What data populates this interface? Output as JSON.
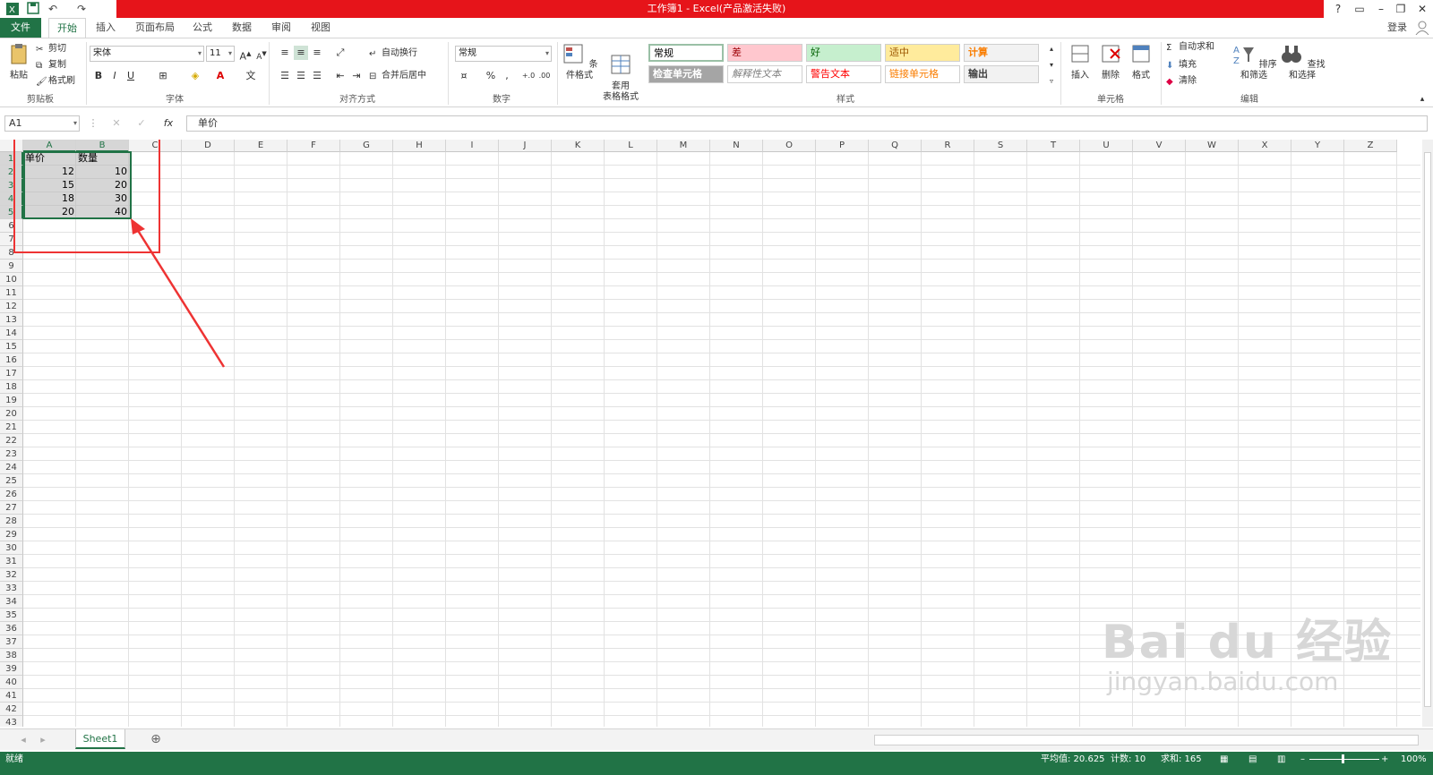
{
  "window": {
    "title": "工作簿1 -  Excel(产品激活失败)",
    "login": "登录",
    "help": "?",
    "minimize": "–",
    "restore": "❐",
    "close": "✕"
  },
  "tabs": [
    "文件",
    "开始",
    "插入",
    "页面布局",
    "公式",
    "数据",
    "审阅",
    "视图"
  ],
  "clipboard": {
    "paste": "粘贴",
    "cut": "剪切",
    "copy": "复制",
    "format_painter": "格式刷",
    "label": "剪贴板"
  },
  "font": {
    "name": "宋体",
    "size": "11",
    "bold": "B",
    "italic": "I",
    "underline": "U",
    "label": "字体"
  },
  "alignment": {
    "wrap": "自动换行",
    "merge": "合并后居中",
    "label": "对齐方式"
  },
  "number": {
    "format": "常规",
    "label": "数字"
  },
  "styles": {
    "cond_format": "条件格式",
    "table_format": "套用\n表格格式",
    "cells": [
      {
        "text": "常规",
        "bg": "#ffffff",
        "color": "#000000"
      },
      {
        "text": "差",
        "bg": "#ffc7ce",
        "color": "#9c0006"
      },
      {
        "text": "好",
        "bg": "#c6efce",
        "color": "#006100"
      },
      {
        "text": "适中",
        "bg": "#ffeb9c",
        "color": "#9c5700"
      },
      {
        "text": "计算",
        "bg": "#f2f2f2",
        "color": "#fa7d00"
      },
      {
        "text": "检查单元格",
        "bg": "#a5a5a5",
        "color": "#ffffff"
      },
      {
        "text": "解释性文本",
        "bg": "#ffffff",
        "color": "#7f7f7f"
      },
      {
        "text": "警告文本",
        "bg": "#ffffff",
        "color": "#ff0000"
      },
      {
        "text": "链接单元格",
        "bg": "#ffffff",
        "color": "#fa7d00"
      },
      {
        "text": "输出",
        "bg": "#f2f2f2",
        "color": "#3f3f3f"
      }
    ],
    "label": "样式"
  },
  "cells_group": {
    "insert": "插入",
    "delete": "删除",
    "format": "格式",
    "label": "单元格"
  },
  "editing": {
    "autosum": "自动求和",
    "fill": "填充",
    "clear": "清除",
    "sort_filter": "排序和筛选",
    "find_select": "查找和选择",
    "label": "编辑"
  },
  "formula_bar": {
    "name_box": "A1",
    "fx": "fx",
    "content": "单价"
  },
  "columns": [
    "A",
    "B",
    "C",
    "D",
    "E",
    "F",
    "G",
    "H",
    "I",
    "J",
    "K",
    "L",
    "M",
    "N",
    "O",
    "P",
    "Q",
    "R",
    "S",
    "T",
    "U",
    "V",
    "W",
    "X",
    "Y",
    "Z"
  ],
  "rows": [
    "1",
    "2",
    "3",
    "4",
    "5",
    "6",
    "7",
    "8",
    "9",
    "10",
    "11",
    "12",
    "13",
    "14",
    "15",
    "16",
    "17",
    "18",
    "19",
    "20",
    "21",
    "22",
    "23",
    "24",
    "25",
    "26",
    "27",
    "28",
    "29",
    "30",
    "31",
    "32",
    "33",
    "34",
    "35",
    "36",
    "37",
    "38",
    "39",
    "40",
    "41",
    "42",
    "43"
  ],
  "data": {
    "headers": [
      "单价",
      "数量"
    ],
    "rows": [
      [
        "12",
        "10"
      ],
      [
        "15",
        "20"
      ],
      [
        "18",
        "30"
      ],
      [
        "20",
        "40"
      ]
    ]
  },
  "sheet": {
    "tab": "Sheet1",
    "add": "⊕"
  },
  "status": {
    "ready": "就绪",
    "average": "平均值: 20.625",
    "count": "计数: 10",
    "sum": "求和: 165",
    "zoom": "100%"
  },
  "watermark": {
    "main": "Bai du 经验",
    "url": "jingyan.baidu.com"
  },
  "accent": "#217346",
  "title_bar_color": "#e6141a"
}
